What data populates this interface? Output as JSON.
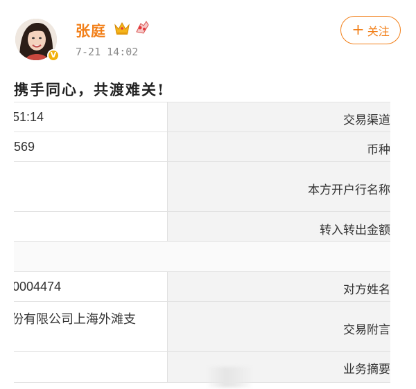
{
  "post": {
    "author": "张庭",
    "verified_badge": "V",
    "time": "7-21 14:02",
    "follow_label": "关注",
    "follow_plus": "+",
    "text": "携手同心，共渡难关!",
    "accent_color": "#f27f18",
    "icons": [
      "crown-icon",
      "fan-badge-icon",
      "verified-icon",
      "plus-icon"
    ]
  },
  "receipt": {
    "rows": [
      {
        "value": "51:14",
        "label": "交易渠道"
      },
      {
        "value": "569",
        "label": "币种"
      },
      {
        "value": "",
        "label": "本方开户行名称"
      },
      {
        "value": "",
        "label": "转入转出金额"
      },
      {
        "value": "0004474",
        "label": "对方姓名"
      },
      {
        "value": "份有限公司上海外滩支",
        "label": "交易附言"
      },
      {
        "value": "",
        "label": "业务摘要"
      }
    ]
  }
}
